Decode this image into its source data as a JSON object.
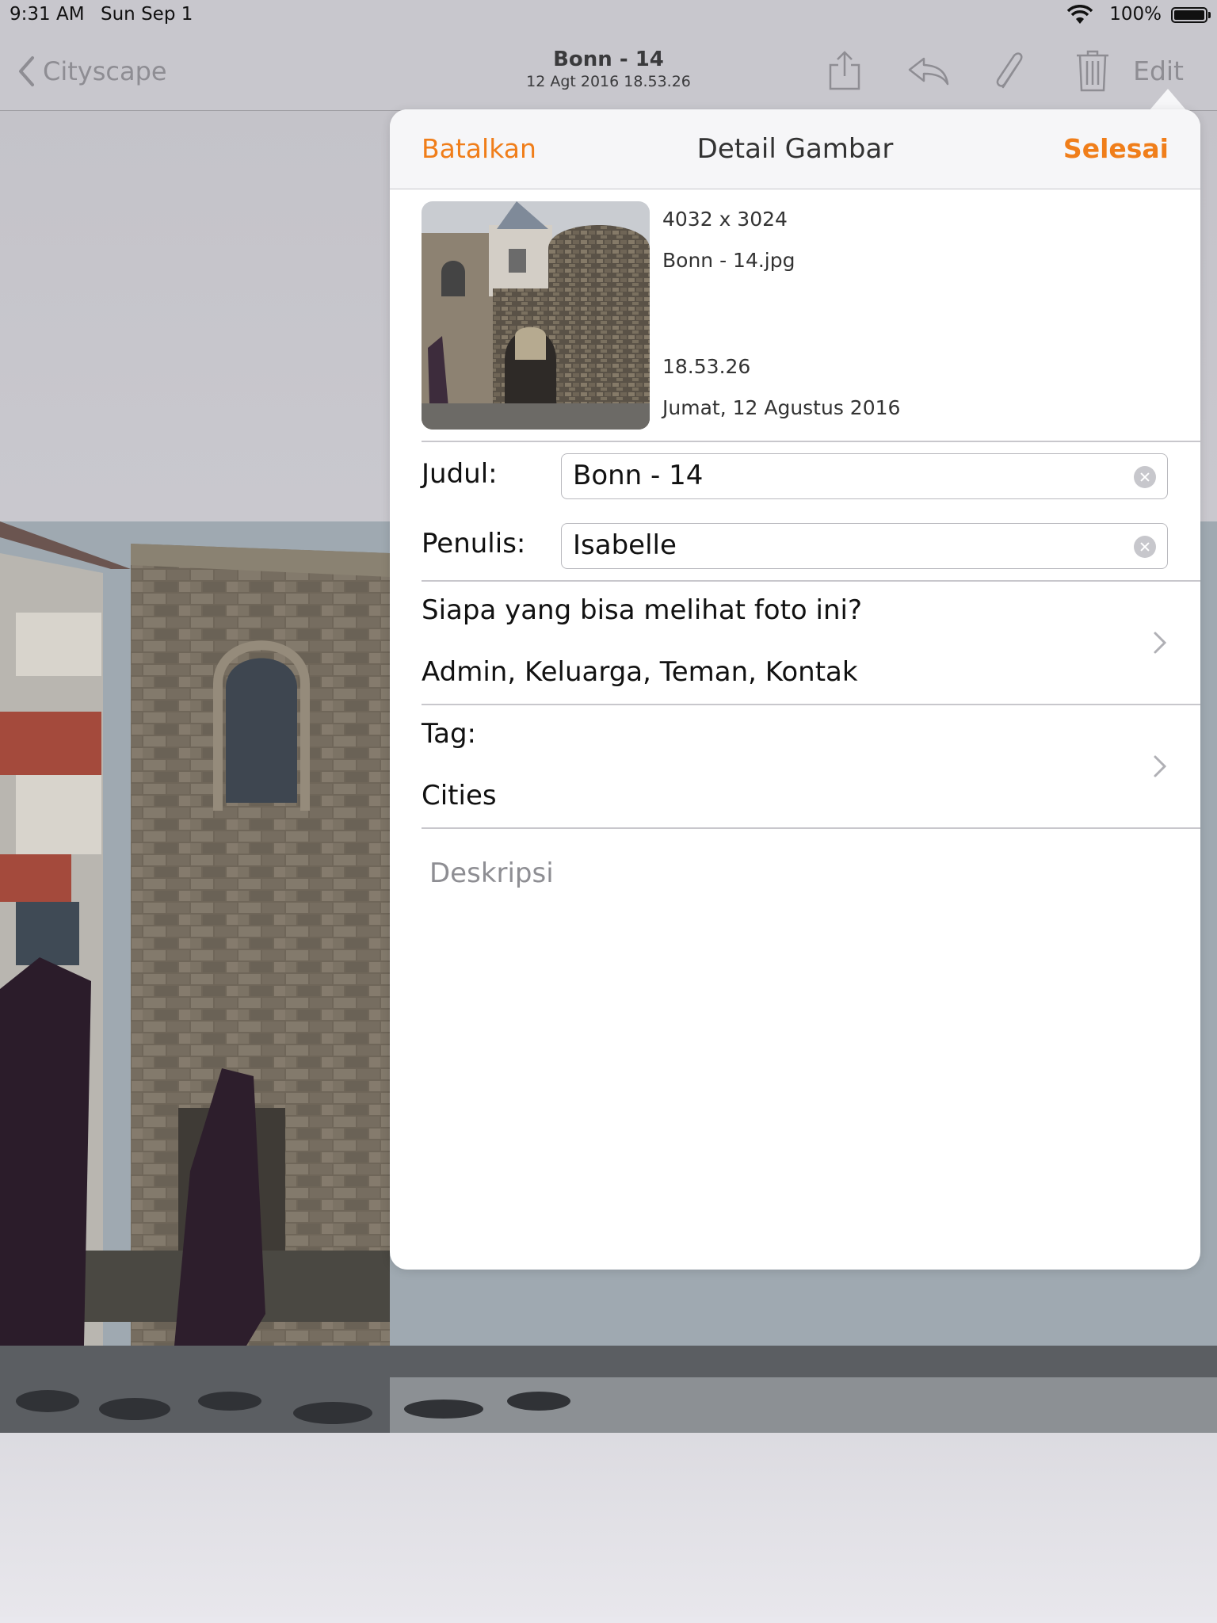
{
  "status_bar": {
    "time": "9:31 AM",
    "date": "Sun Sep 1",
    "battery": "100%"
  },
  "nav": {
    "back_label": "Cityscape",
    "title": "Bonn - 14",
    "subtitle": "12 Agt 2016 18.53.26",
    "edit_label": "Edit",
    "icons": [
      "share-icon",
      "reply-icon",
      "attachment-icon",
      "trash-icon"
    ]
  },
  "popover": {
    "cancel_label": "Batalkan",
    "title": "Detail Gambar",
    "done_label": "Selesai",
    "accent_color": "#f07e1a",
    "image_info": {
      "dimensions": "4032 x 3024",
      "filename": "Bonn - 14.jpg",
      "time": "18.53.26",
      "date": "Jumat, 12 Agustus 2016"
    },
    "title_field": {
      "label": "Judul:",
      "value": "Bonn - 14"
    },
    "author_field": {
      "label": "Penulis:",
      "value": "Isabelle"
    },
    "visibility": {
      "label": "Siapa yang bisa melihat foto ini?",
      "value": "Admin, Keluarga, Teman, Kontak"
    },
    "tags": {
      "label": "Tag:",
      "value": "Cities"
    },
    "description_placeholder": "Deskripsi"
  }
}
